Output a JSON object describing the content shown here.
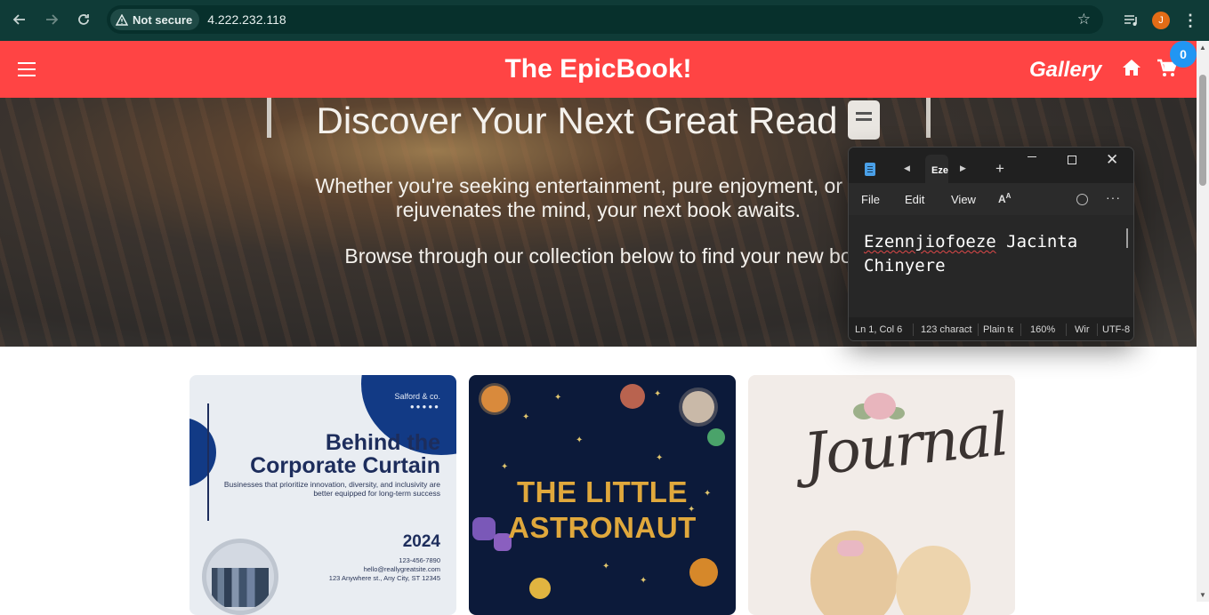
{
  "browser": {
    "security_label": "Not secure",
    "url": "4.222.232.118",
    "profile_initial": "J"
  },
  "header": {
    "title": "The EpicBook!",
    "gallery_label": "Gallery",
    "cart_count": "0"
  },
  "hero": {
    "title": "Discover Your Next Great Read",
    "subtitle_line1": "Whether you're seeking entertainment, pure enjoyment, or a jo",
    "subtitle_line2": "rejuvenates the mind, your next book awaits.",
    "browse_text": "Browse through our collection below to find your new bo"
  },
  "books": [
    {
      "brand": "Salford & co.",
      "title_line1": "Behind the",
      "title_line2": "Corporate Curtain",
      "description": "Businesses that prioritize innovation, diversity, and inclusivity are better equipped for long-term success",
      "year": "2024",
      "phone": "123-456-7890",
      "email": "hello@reallygreatsite.com",
      "address": "123 Anywhere st., Any City, ST 12345"
    },
    {
      "title_line1": "THE LITTLE",
      "title_line2": "ASTRONAUT"
    },
    {
      "title": "Journal"
    }
  ],
  "notepad": {
    "tab_label": "Eze",
    "menu": [
      "File",
      "Edit",
      "View"
    ],
    "text_line1_word1": "Ezennjiofoeze",
    "text_line1_word2": "Jacinta",
    "text_line2": "Chinyere",
    "status": {
      "position": "Ln 1, Col 6",
      "chars": "123 charact",
      "format": "Plain te",
      "zoom": "160%",
      "line_ending": "Wir",
      "encoding": "UTF-8"
    }
  },
  "colors": {
    "header_bg": "#ff4444",
    "badge_bg": "#2196f3",
    "chrome_bg": "#0f3b37"
  }
}
